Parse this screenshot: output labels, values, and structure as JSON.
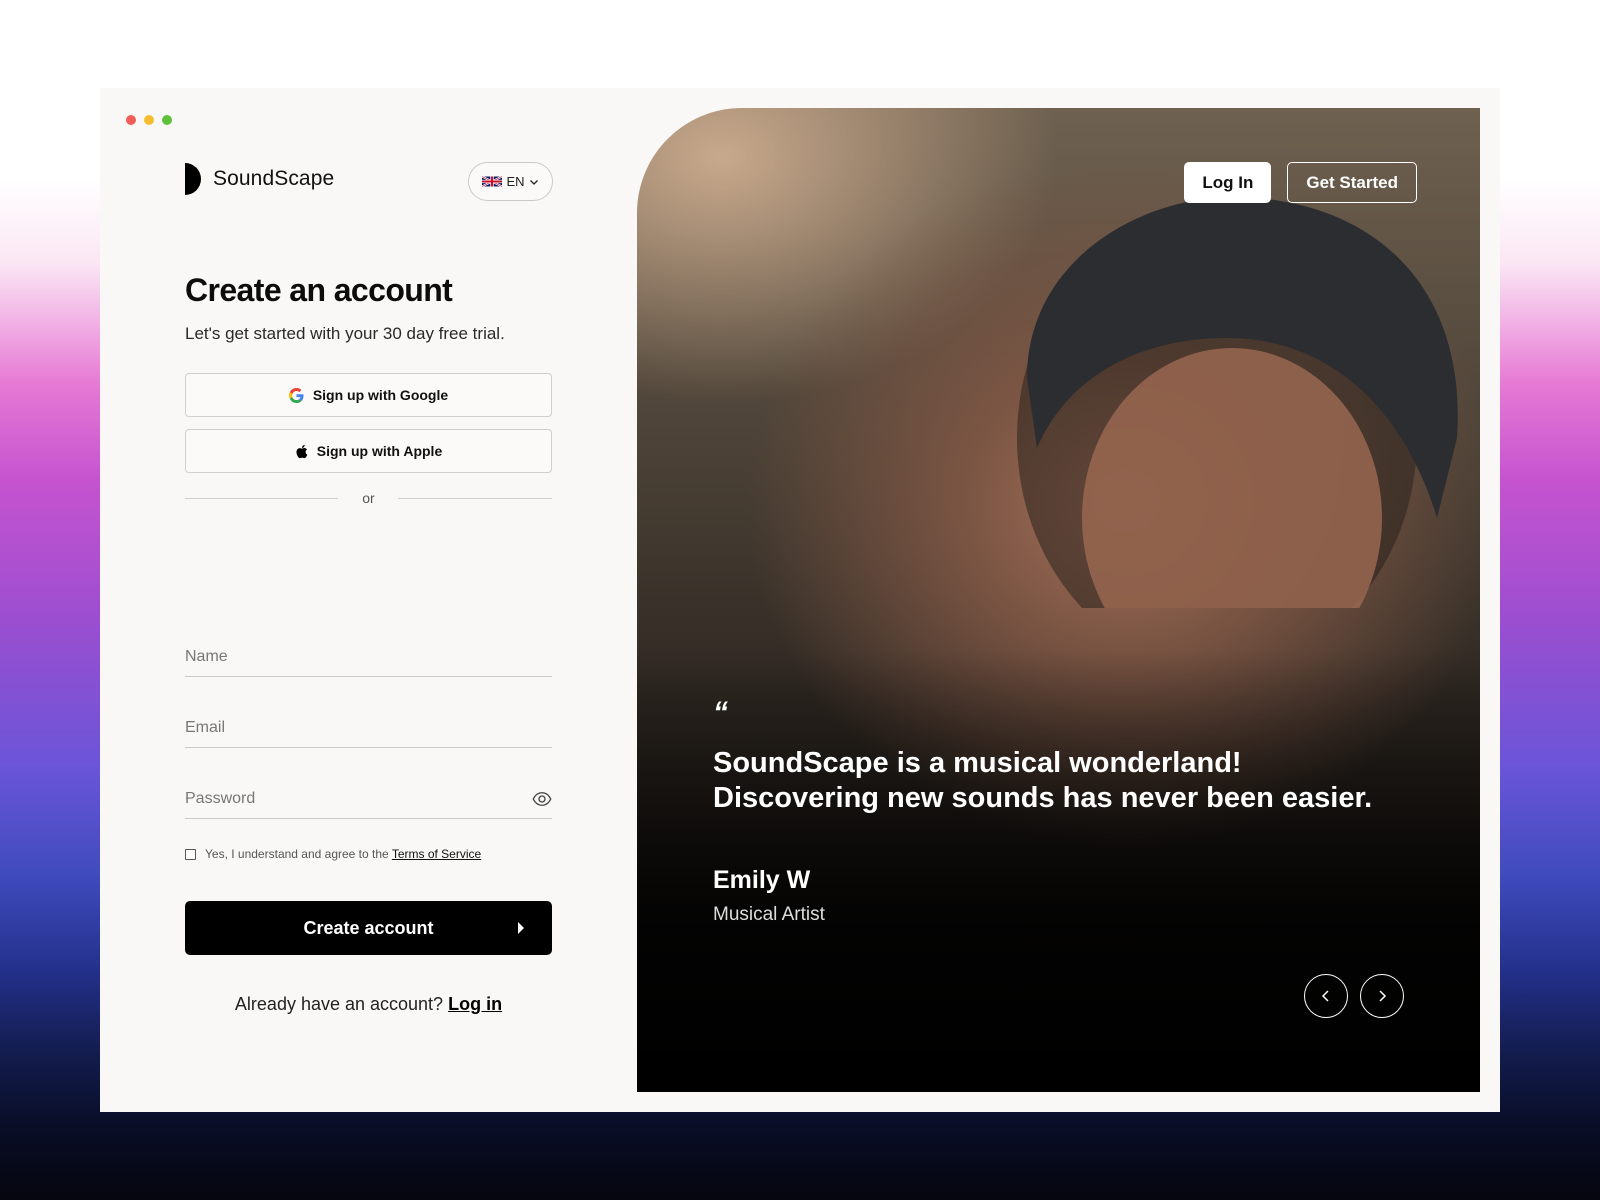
{
  "window": {
    "controls": [
      "close",
      "minimize",
      "maximize"
    ]
  },
  "brand": {
    "name": "SoundScape"
  },
  "language": {
    "selected": "EN",
    "flag_icon": "uk-flag-icon"
  },
  "form": {
    "title": "Create an account",
    "subtitle": "Let's get started with your 30 day free trial.",
    "google_label": "Sign up with Google",
    "apple_label": "Sign up with Apple",
    "divider_text": "or",
    "name_placeholder": "Name",
    "email_placeholder": "Email",
    "password_placeholder": "Password",
    "terms_text": "Yes, I understand and agree to the",
    "terms_link": "Terms of Service",
    "submit_label": "Create account",
    "login_prompt": "Already have an account?",
    "login_link": "Log in"
  },
  "hero": {
    "login_label": "Log In",
    "get_started_label": "Get Started",
    "quote_mark": "“",
    "quote": "SoundScape is a musical wonderland! Discovering new sounds has never been easier.",
    "author": "Emily W",
    "role": "Musical Artist"
  },
  "colors": {
    "accent": "#000000",
    "panel_bg": "#f9f8f6",
    "dot_red": "#ef5f57",
    "dot_yellow": "#f4bd30",
    "dot_green": "#5dc23a"
  }
}
